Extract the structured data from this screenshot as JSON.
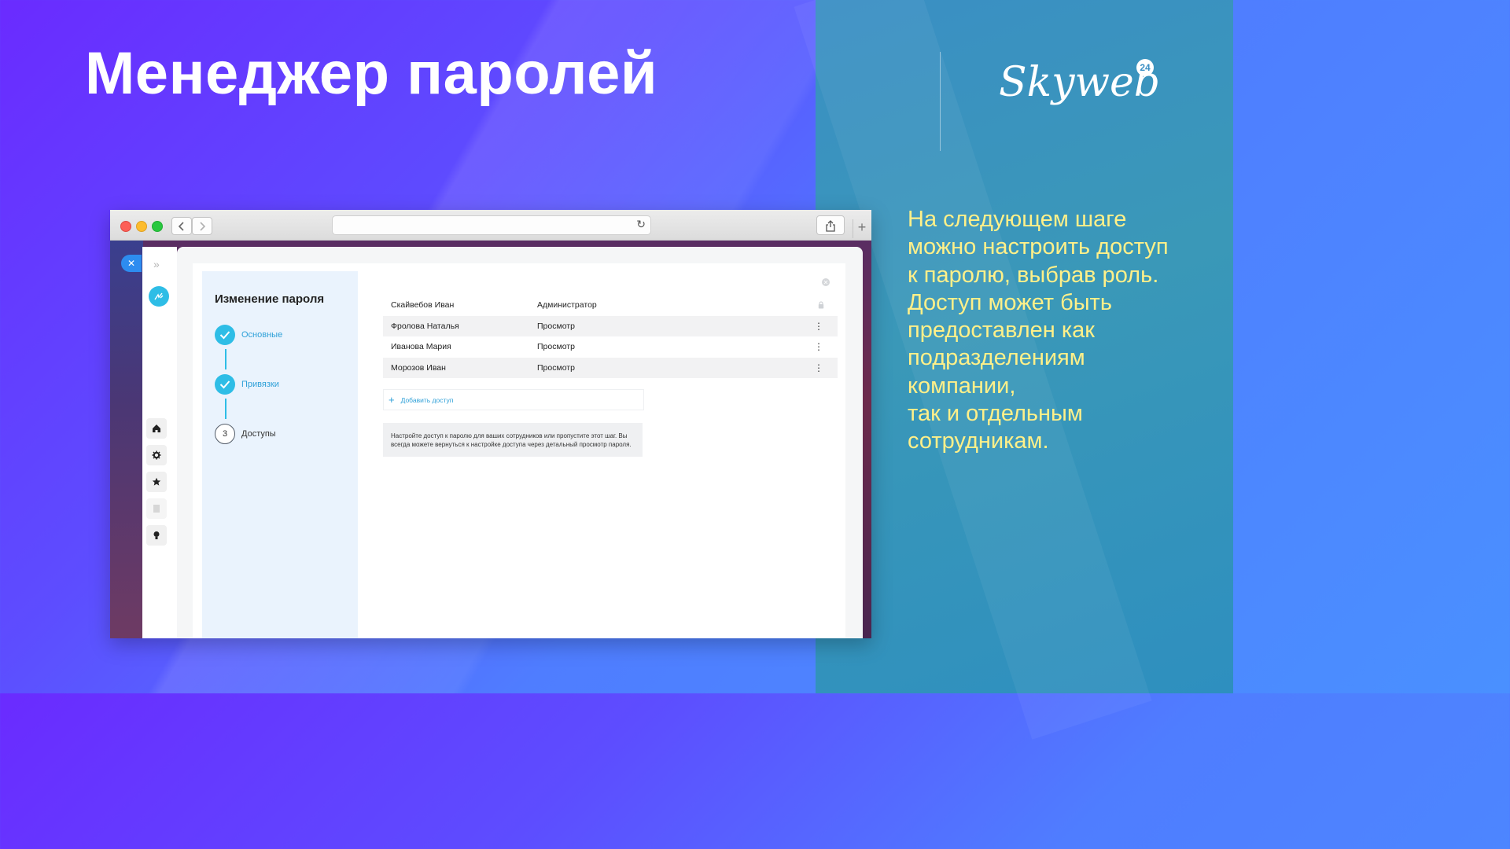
{
  "slide": {
    "title": "Менеджер паролей",
    "logo_text": "Skyweb",
    "logo_badge": "24",
    "description_lines": [
      "На следующем шаге",
      "можно настроить доступ",
      "к паролю, выбрав роль.",
      "Доступ может быть",
      "предоставлен как",
      "подразделениям",
      "компании,",
      "так и отдельным",
      "сотрудникам."
    ]
  },
  "browser": {
    "back_icon": "chevron-left-icon",
    "forward_icon": "chevron-right-icon",
    "reload_icon": "reload-icon",
    "share_icon": "share-icon",
    "new_tab_label": "+"
  },
  "dialog": {
    "title": "Изменение пароля",
    "steps": [
      {
        "label": "Основные",
        "state": "done"
      },
      {
        "label": "Привязки",
        "state": "done"
      },
      {
        "number": "3",
        "label": "Доступы",
        "state": "current"
      }
    ],
    "access_rows": [
      {
        "name": "Скайвебов Иван",
        "role": "Администратор",
        "action": "lock-icon"
      },
      {
        "name": "Фролова Наталья",
        "role": "Просмотр",
        "action": "more-icon"
      },
      {
        "name": "Иванова Мария",
        "role": "Просмотр",
        "action": "more-icon"
      },
      {
        "name": "Морозов Иван",
        "role": "Просмотр",
        "action": "more-icon"
      }
    ],
    "add_access_label": "Добавить доступ",
    "hint_text": "Настройте доступ к паролю для ваших сотрудников или пропустите этот шаг. Вы всегда можете вернуться к настройке доступа через детальный просмотр пароля."
  },
  "colors": {
    "accent": "#2ebde6",
    "link": "#2ea0d8",
    "description": "#fff089"
  }
}
